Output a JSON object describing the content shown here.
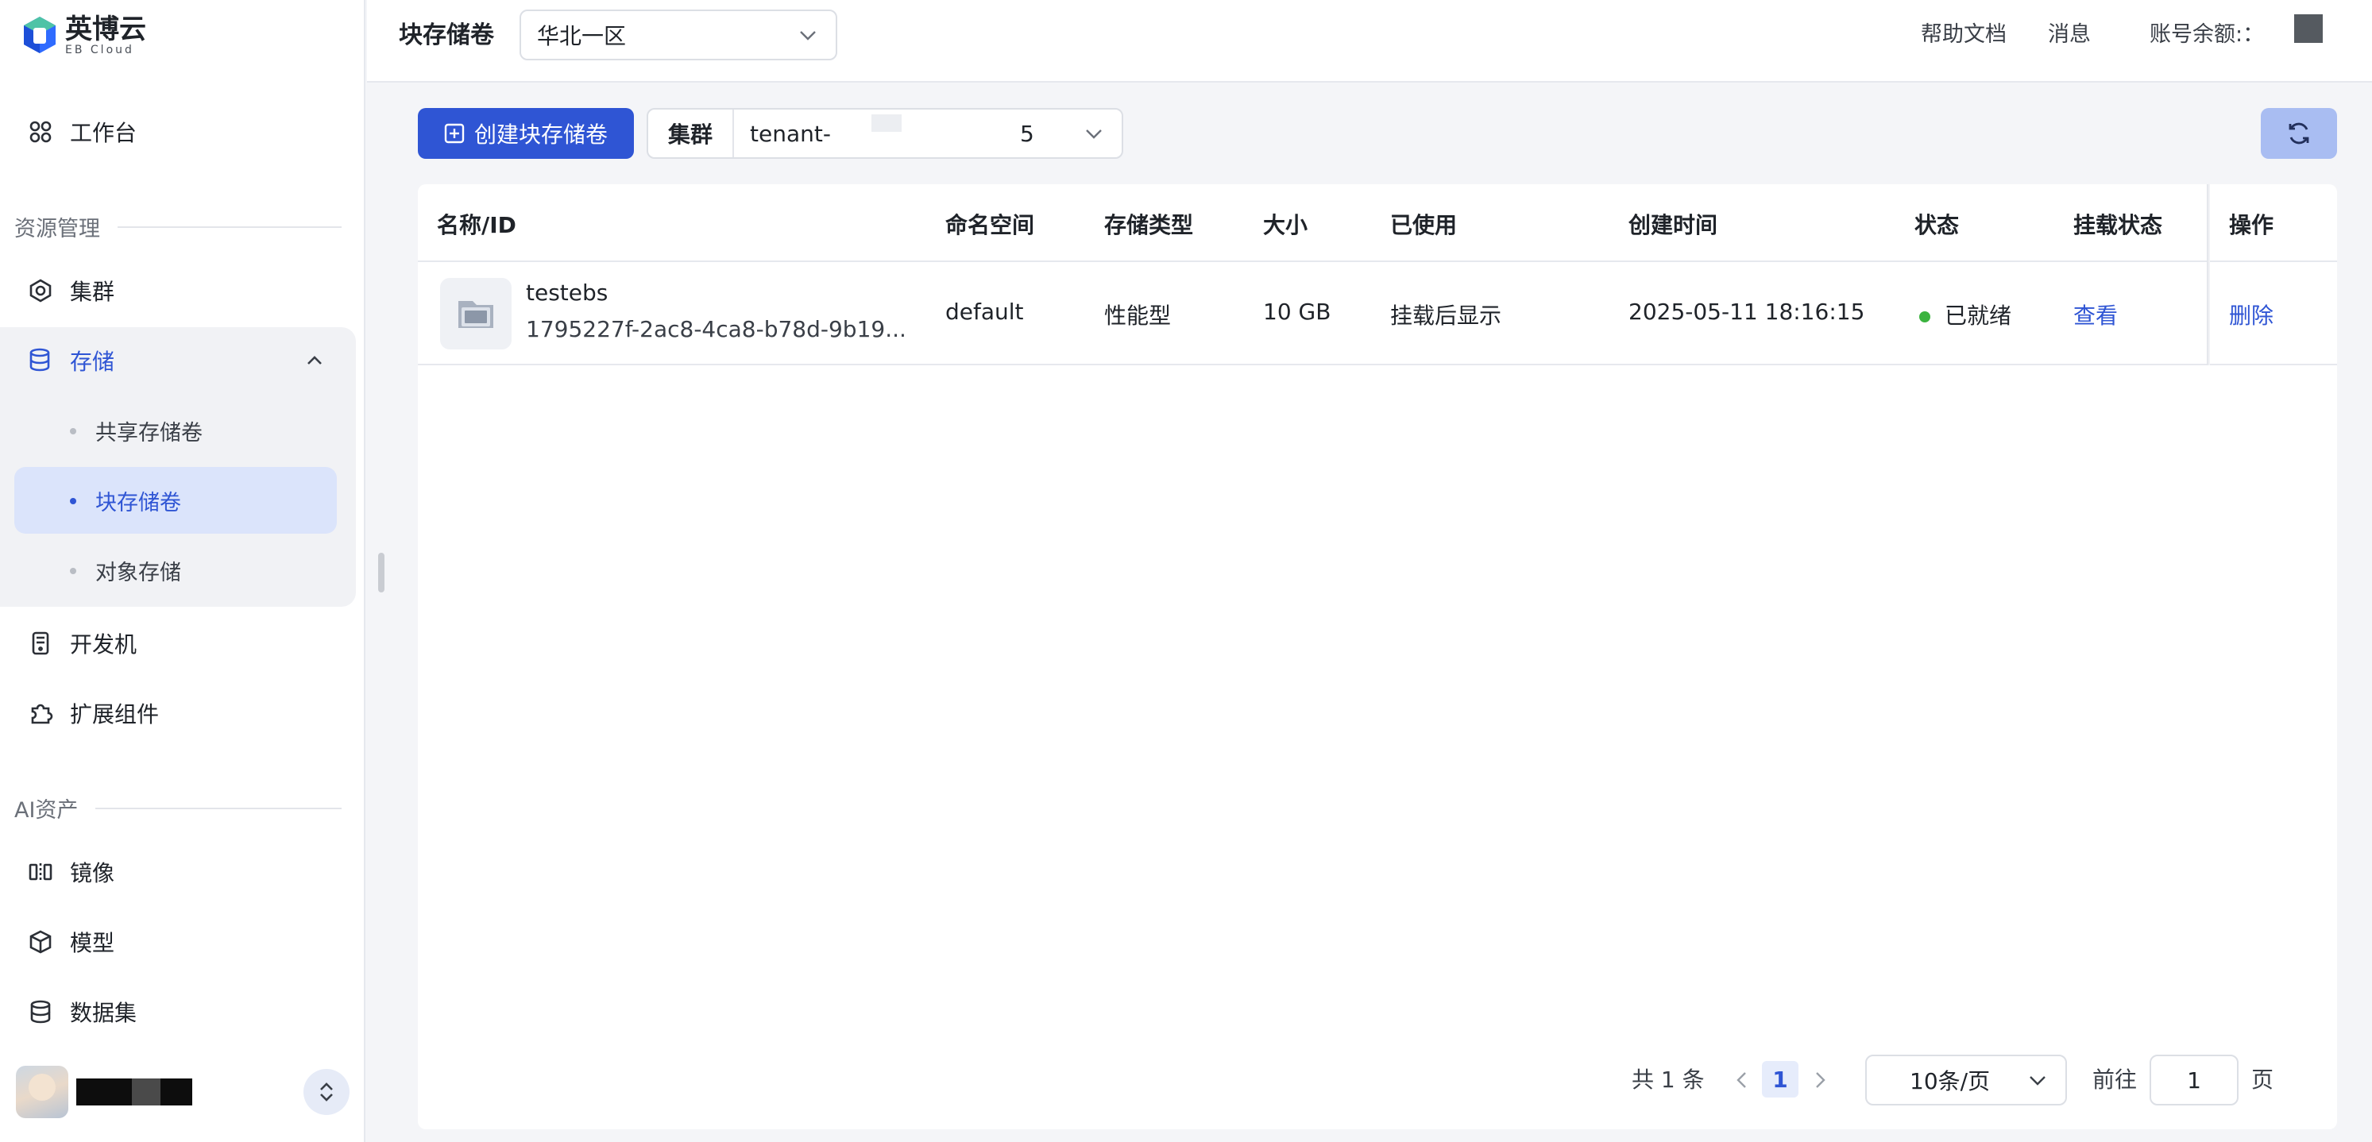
{
  "brand": {
    "name_cn": "英博云",
    "name_en": "EB Cloud"
  },
  "sidebar": {
    "workbench": "工作台",
    "section_resources": "资源管理",
    "cluster": "集群",
    "storage": "存储",
    "storage_children": [
      "共享存储卷",
      "块存储卷",
      "对象存储"
    ],
    "devmachine": "开发机",
    "extensions": "扩展组件",
    "section_ai": "AI资产",
    "image": "镜像",
    "model": "模型",
    "dataset": "数据集"
  },
  "header": {
    "title": "块存储卷",
    "region": "华北一区",
    "help": "帮助文档",
    "messages": "消息",
    "balance": "账号余额:："
  },
  "toolbar": {
    "create_label": "创建块存储卷",
    "cluster_label": "集群",
    "cluster_value_prefix": "tenant-",
    "cluster_value_suffix": "5"
  },
  "table": {
    "columns": [
      "名称/ID",
      "命名空间",
      "存储类型",
      "大小",
      "已使用",
      "创建时间",
      "状态",
      "挂载状态",
      "操作"
    ],
    "rows": [
      {
        "name": "testebs",
        "id": "1795227f-2ac8-4ca8-b78d-9b19...",
        "namespace": "default",
        "type": "性能型",
        "size": "10 GB",
        "used": "挂载后显示",
        "created": "2025-05-11 18:16:15",
        "status": "已就绪",
        "mount": "查看",
        "action": "删除"
      }
    ]
  },
  "pagination": {
    "total": "共 1 条",
    "current": "1",
    "page_size": "10条/页",
    "goto_label": "前往",
    "goto_value": "1",
    "page_suffix": "页"
  },
  "colors": {
    "accent": "#2f55d4",
    "status_ready": "#3bb33f",
    "refresh_bg": "#a9bdf2"
  }
}
